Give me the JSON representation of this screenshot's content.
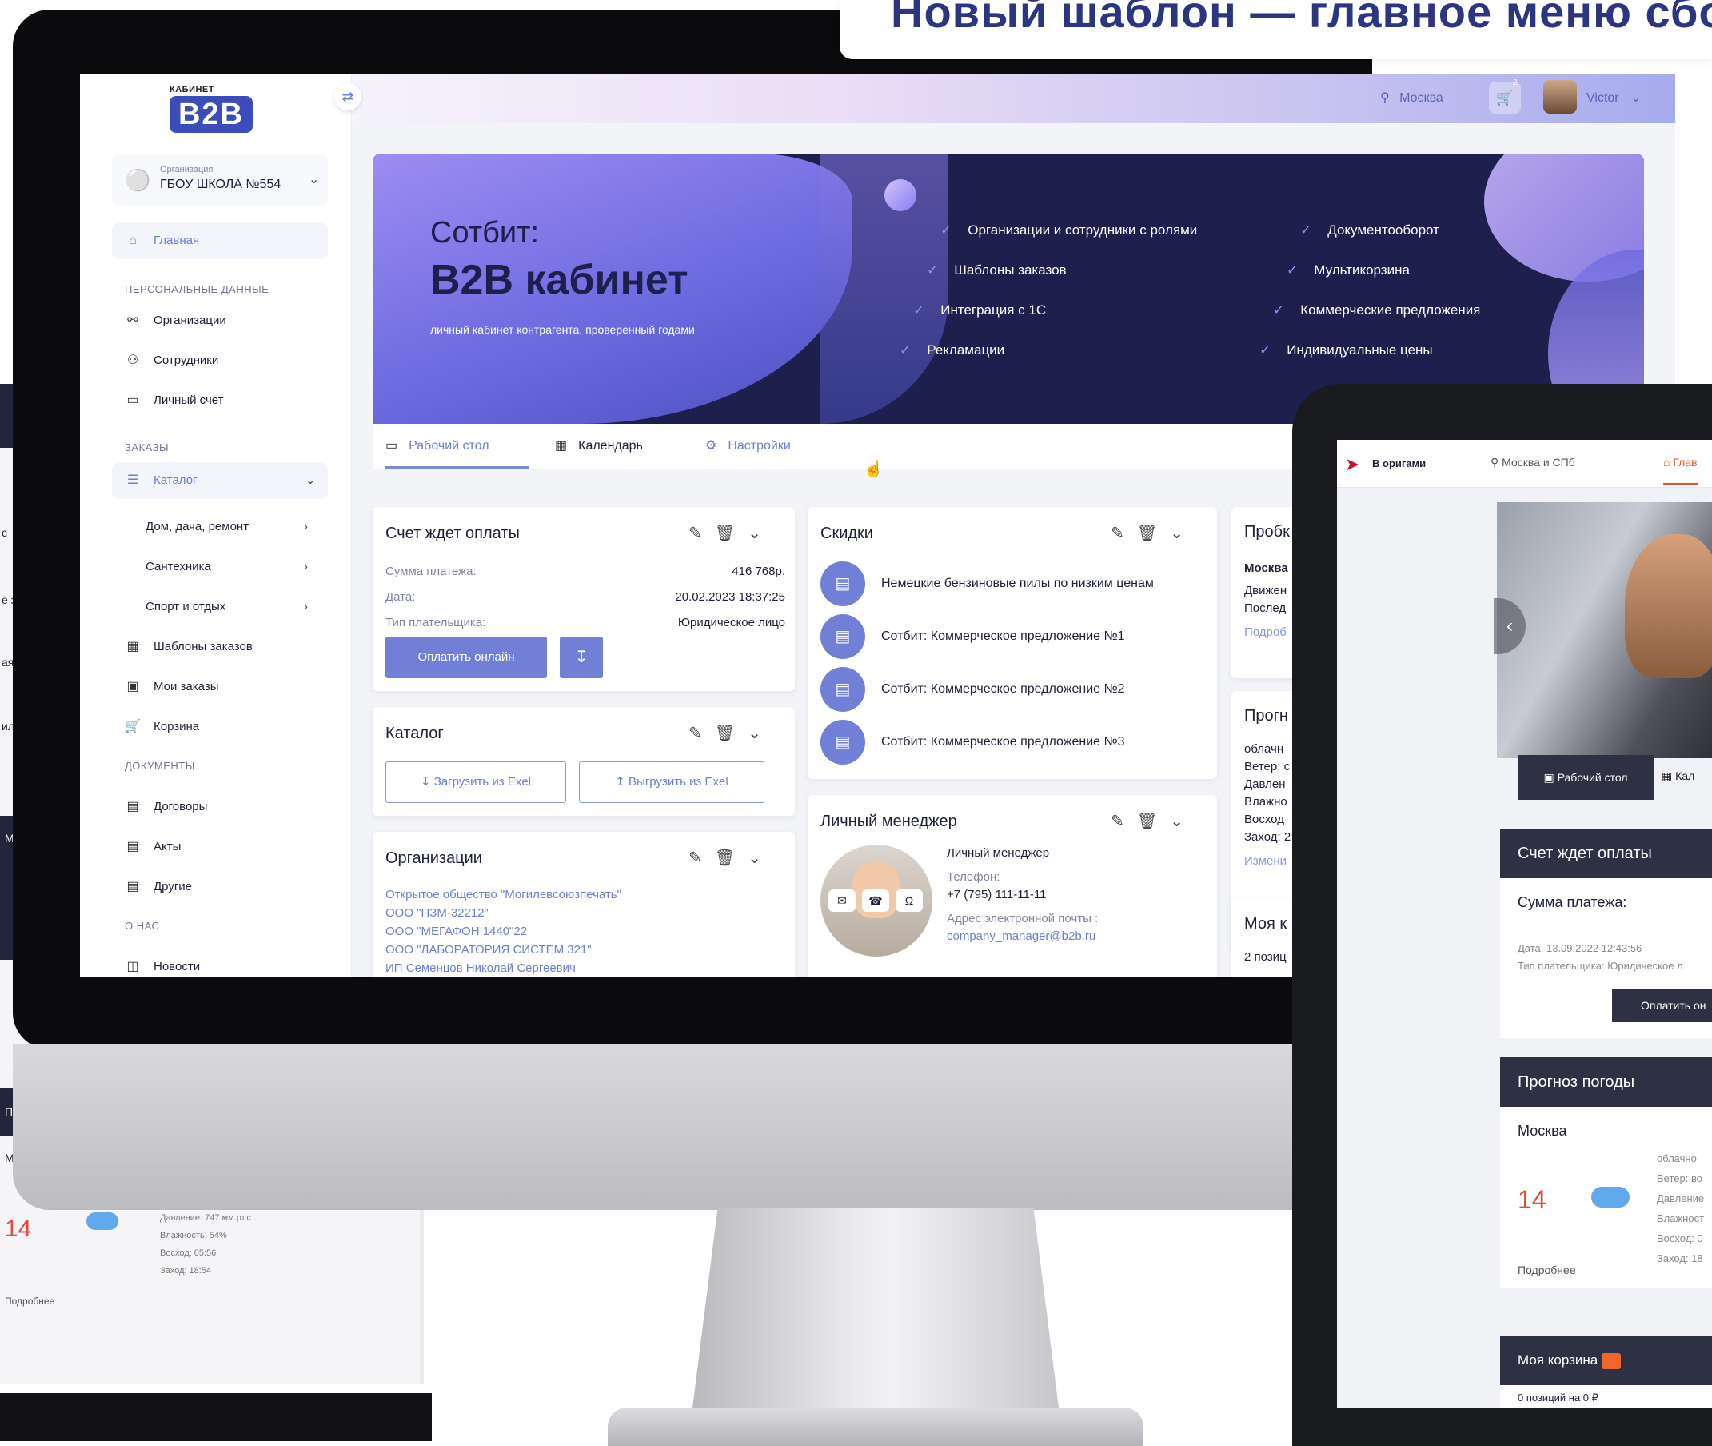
{
  "headline": "Новый шаблон — главное меню сбо",
  "topbar": {
    "city": "Москва",
    "cart_count": "2",
    "user": "Victor"
  },
  "logo": {
    "small": "КАБИНЕТ",
    "big": "B2B"
  },
  "org": {
    "label": "Организация",
    "value": "ГБОУ ШКОЛА №554"
  },
  "sidebar": {
    "home": "Главная",
    "sec_personal": "ПЕРСОНАЛЬНЫЕ ДАННЫЕ",
    "organizations": "Организации",
    "employees": "Сотрудники",
    "account": "Личный счет",
    "sec_orders": "ЗАКАЗЫ",
    "catalog": "Каталог",
    "cat_items": [
      "Дом, дача, ремонт",
      "Сантехника",
      "Спорт и отдых"
    ],
    "templates": "Шаблоны заказов",
    "my_orders": "Мои заказы",
    "cart": "Корзина",
    "sec_docs": "ДОКУМЕНТЫ",
    "contracts": "Договоры",
    "acts": "Акты",
    "others": "Другие",
    "sec_about": "О НАС",
    "news": "Новости"
  },
  "banner": {
    "title1": "Сотбит:",
    "title2": "B2B кабинет",
    "subtitle": "личный кабинет контрагента, проверенный годами",
    "features_left": [
      "Организации и сотрудники с ролями",
      "Шаблоны заказов",
      "Интеграция с 1С",
      "Рекламации"
    ],
    "features_right": [
      "Документооборот",
      "Мультикорзина",
      "Коммерческие предложения",
      "Индивидуальные цены"
    ]
  },
  "tabs": [
    "Рабочий стол",
    "Календарь",
    "Настройки"
  ],
  "invoice": {
    "title": "Счет ждет оплаты",
    "sum_label": "Сумма платежа:",
    "sum": "416 768р.",
    "date_label": "Дата:",
    "date": "20.02.2023 18:37:25",
    "payer_label": "Тип плательщика:",
    "payer": "Юридическое лицо",
    "pay_btn": "Оплатить онлайн"
  },
  "catalog_card": {
    "title": "Каталог",
    "upload": "Загрузить из Exel",
    "download": "Выгрузить из Exel"
  },
  "orgs_card": {
    "title": "Организации",
    "items": [
      "Открытое  общество \"Могилевсоюзпечать\"",
      "ООО \"ПЗМ-32212\"",
      "ООО \"МЕГАФОН 1440\"22",
      "ООО \"ЛАБОРАТОРИЯ СИСТЕМ 321\"",
      "ИП Семенцов Николай Сергеевич"
    ]
  },
  "discounts": {
    "title": "Скидки",
    "items": [
      "Немецкие бензиновые пилы по низким ценам",
      "Сотбит: Коммерческое предложение №1",
      "Сотбит: Коммерческое предложение №2",
      "Сотбит: Коммерческое предложение №3"
    ]
  },
  "manager": {
    "title": "Личный менеджер",
    "role": "Личный менеджер",
    "phone_label": "Телефон:",
    "phone": "+7 (795) 111-11-11",
    "email_label": "Адрес электронной почты :",
    "email": "company_manager@b2b.ru"
  },
  "right_col": {
    "probki": "Пробк",
    "city": "Москва",
    "l1": "Движен",
    "l2": "Послед",
    "more": "Подроб",
    "prognoz": "Прогн",
    "w1": "облачн",
    "w2": "Ветер: с",
    "w3": "Давлен",
    "w4": "Влажно",
    "w5": "Восход",
    "w6": "Заход: 2",
    "change": "Измени",
    "mine": "Моя к",
    "positions": "2 позиц"
  },
  "left_laptop": {
    "temp": "14",
    "pressure": "Давление: 747 мм.рт.ст.",
    "humidity": "Влажность: 54%",
    "sunrise": "Восход: 05:56",
    "sunset": "Заход: 18:54",
    "more": "Подробнее",
    "letters": [
      "с",
      "е з",
      "ая",
      "ил",
      "М",
      "П",
      "М"
    ]
  },
  "tablet": {
    "brand": "В оригами",
    "city": "Москва и СПб",
    "home": "Глав",
    "tab1": "Рабочий стол",
    "tab2": "Кал",
    "invoice_title": "Счет ждет оплаты",
    "sum_label": "Сумма платежа:",
    "date": "Дата: 13.09.2022 12:43:56",
    "payer": "Тип плательщика: Юридическое л",
    "pay": "Оплатить он",
    "weather_title": "Прогноз погоды",
    "city2": "Москва",
    "temp": "14",
    "w": [
      "облачно",
      "Ветер: во",
      "Давление",
      "Влажност",
      "Восход: 0",
      "Заход: 18"
    ],
    "more": "Подробнее",
    "cart_title": "Моя корзина",
    "cart_sub": "0 позиций на 0 ₽"
  }
}
